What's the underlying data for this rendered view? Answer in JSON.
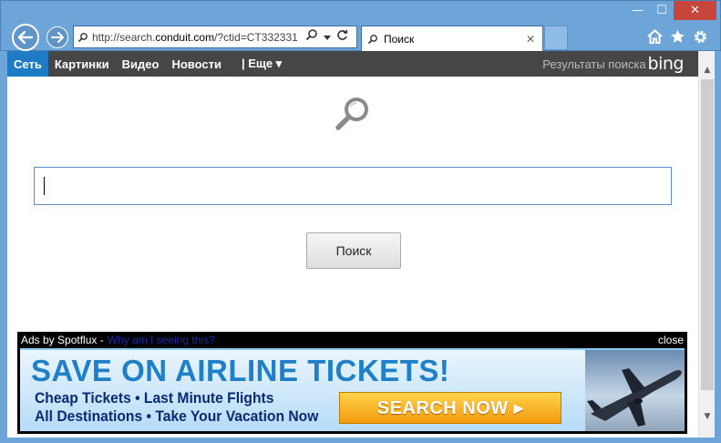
{
  "window": {
    "minimize": "—",
    "maximize": "☐",
    "close": "✕"
  },
  "address_bar": {
    "url_prefix": "http://search.",
    "url_host": "conduit.com",
    "url_suffix": "/?ctid=CT332331"
  },
  "tab": {
    "label": "Поиск",
    "close": "✕"
  },
  "bing_bar": {
    "items": [
      "Сеть",
      "Картинки",
      "Видео",
      "Новости"
    ],
    "more": "| Еще ▾",
    "results_label": "Результаты поиска",
    "logo": "bing",
    "active_color": "#1e7bc4"
  },
  "search": {
    "value": "",
    "button_label": "Поиск"
  },
  "ad": {
    "source": "Ads by Spotflux -",
    "why": "Why am I seeing this?",
    "close": "close",
    "headline": "SAVE ON AIRLINE TICKETS!",
    "line1": "Cheap Tickets  •  Last Minute Flights",
    "line2": "All Destinations  • Take Your Vacation Now",
    "cta": "SEARCH NOW ▸"
  },
  "icons": [
    "back-icon",
    "forward-icon",
    "page-icon",
    "search-icon",
    "refresh-icon",
    "home-icon",
    "favorites-icon",
    "gear-icon",
    "magnifier-icon",
    "airplane-icon"
  ]
}
